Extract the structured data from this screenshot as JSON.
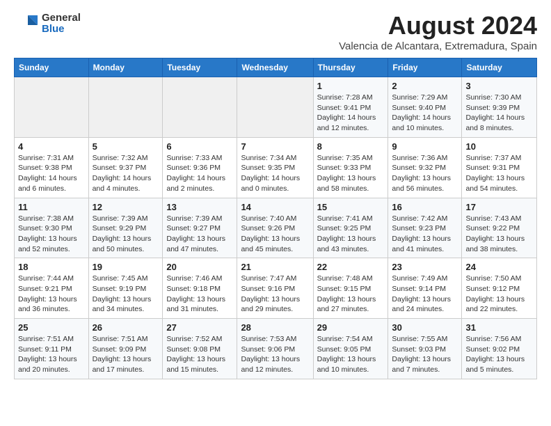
{
  "header": {
    "logo_general": "General",
    "logo_blue": "Blue",
    "month_year": "August 2024",
    "location": "Valencia de Alcantara, Extremadura, Spain"
  },
  "weekdays": [
    "Sunday",
    "Monday",
    "Tuesday",
    "Wednesday",
    "Thursday",
    "Friday",
    "Saturday"
  ],
  "weeks": [
    [
      {
        "day": "",
        "info": ""
      },
      {
        "day": "",
        "info": ""
      },
      {
        "day": "",
        "info": ""
      },
      {
        "day": "",
        "info": ""
      },
      {
        "day": "1",
        "info": "Sunrise: 7:28 AM\nSunset: 9:41 PM\nDaylight: 14 hours and 12 minutes."
      },
      {
        "day": "2",
        "info": "Sunrise: 7:29 AM\nSunset: 9:40 PM\nDaylight: 14 hours and 10 minutes."
      },
      {
        "day": "3",
        "info": "Sunrise: 7:30 AM\nSunset: 9:39 PM\nDaylight: 14 hours and 8 minutes."
      }
    ],
    [
      {
        "day": "4",
        "info": "Sunrise: 7:31 AM\nSunset: 9:38 PM\nDaylight: 14 hours and 6 minutes."
      },
      {
        "day": "5",
        "info": "Sunrise: 7:32 AM\nSunset: 9:37 PM\nDaylight: 14 hours and 4 minutes."
      },
      {
        "day": "6",
        "info": "Sunrise: 7:33 AM\nSunset: 9:36 PM\nDaylight: 14 hours and 2 minutes."
      },
      {
        "day": "7",
        "info": "Sunrise: 7:34 AM\nSunset: 9:35 PM\nDaylight: 14 hours and 0 minutes."
      },
      {
        "day": "8",
        "info": "Sunrise: 7:35 AM\nSunset: 9:33 PM\nDaylight: 13 hours and 58 minutes."
      },
      {
        "day": "9",
        "info": "Sunrise: 7:36 AM\nSunset: 9:32 PM\nDaylight: 13 hours and 56 minutes."
      },
      {
        "day": "10",
        "info": "Sunrise: 7:37 AM\nSunset: 9:31 PM\nDaylight: 13 hours and 54 minutes."
      }
    ],
    [
      {
        "day": "11",
        "info": "Sunrise: 7:38 AM\nSunset: 9:30 PM\nDaylight: 13 hours and 52 minutes."
      },
      {
        "day": "12",
        "info": "Sunrise: 7:39 AM\nSunset: 9:29 PM\nDaylight: 13 hours and 50 minutes."
      },
      {
        "day": "13",
        "info": "Sunrise: 7:39 AM\nSunset: 9:27 PM\nDaylight: 13 hours and 47 minutes."
      },
      {
        "day": "14",
        "info": "Sunrise: 7:40 AM\nSunset: 9:26 PM\nDaylight: 13 hours and 45 minutes."
      },
      {
        "day": "15",
        "info": "Sunrise: 7:41 AM\nSunset: 9:25 PM\nDaylight: 13 hours and 43 minutes."
      },
      {
        "day": "16",
        "info": "Sunrise: 7:42 AM\nSunset: 9:23 PM\nDaylight: 13 hours and 41 minutes."
      },
      {
        "day": "17",
        "info": "Sunrise: 7:43 AM\nSunset: 9:22 PM\nDaylight: 13 hours and 38 minutes."
      }
    ],
    [
      {
        "day": "18",
        "info": "Sunrise: 7:44 AM\nSunset: 9:21 PM\nDaylight: 13 hours and 36 minutes."
      },
      {
        "day": "19",
        "info": "Sunrise: 7:45 AM\nSunset: 9:19 PM\nDaylight: 13 hours and 34 minutes."
      },
      {
        "day": "20",
        "info": "Sunrise: 7:46 AM\nSunset: 9:18 PM\nDaylight: 13 hours and 31 minutes."
      },
      {
        "day": "21",
        "info": "Sunrise: 7:47 AM\nSunset: 9:16 PM\nDaylight: 13 hours and 29 minutes."
      },
      {
        "day": "22",
        "info": "Sunrise: 7:48 AM\nSunset: 9:15 PM\nDaylight: 13 hours and 27 minutes."
      },
      {
        "day": "23",
        "info": "Sunrise: 7:49 AM\nSunset: 9:14 PM\nDaylight: 13 hours and 24 minutes."
      },
      {
        "day": "24",
        "info": "Sunrise: 7:50 AM\nSunset: 9:12 PM\nDaylight: 13 hours and 22 minutes."
      }
    ],
    [
      {
        "day": "25",
        "info": "Sunrise: 7:51 AM\nSunset: 9:11 PM\nDaylight: 13 hours and 20 minutes."
      },
      {
        "day": "26",
        "info": "Sunrise: 7:51 AM\nSunset: 9:09 PM\nDaylight: 13 hours and 17 minutes."
      },
      {
        "day": "27",
        "info": "Sunrise: 7:52 AM\nSunset: 9:08 PM\nDaylight: 13 hours and 15 minutes."
      },
      {
        "day": "28",
        "info": "Sunrise: 7:53 AM\nSunset: 9:06 PM\nDaylight: 13 hours and 12 minutes."
      },
      {
        "day": "29",
        "info": "Sunrise: 7:54 AM\nSunset: 9:05 PM\nDaylight: 13 hours and 10 minutes."
      },
      {
        "day": "30",
        "info": "Sunrise: 7:55 AM\nSunset: 9:03 PM\nDaylight: 13 hours and 7 minutes."
      },
      {
        "day": "31",
        "info": "Sunrise: 7:56 AM\nSunset: 9:02 PM\nDaylight: 13 hours and 5 minutes."
      }
    ]
  ]
}
